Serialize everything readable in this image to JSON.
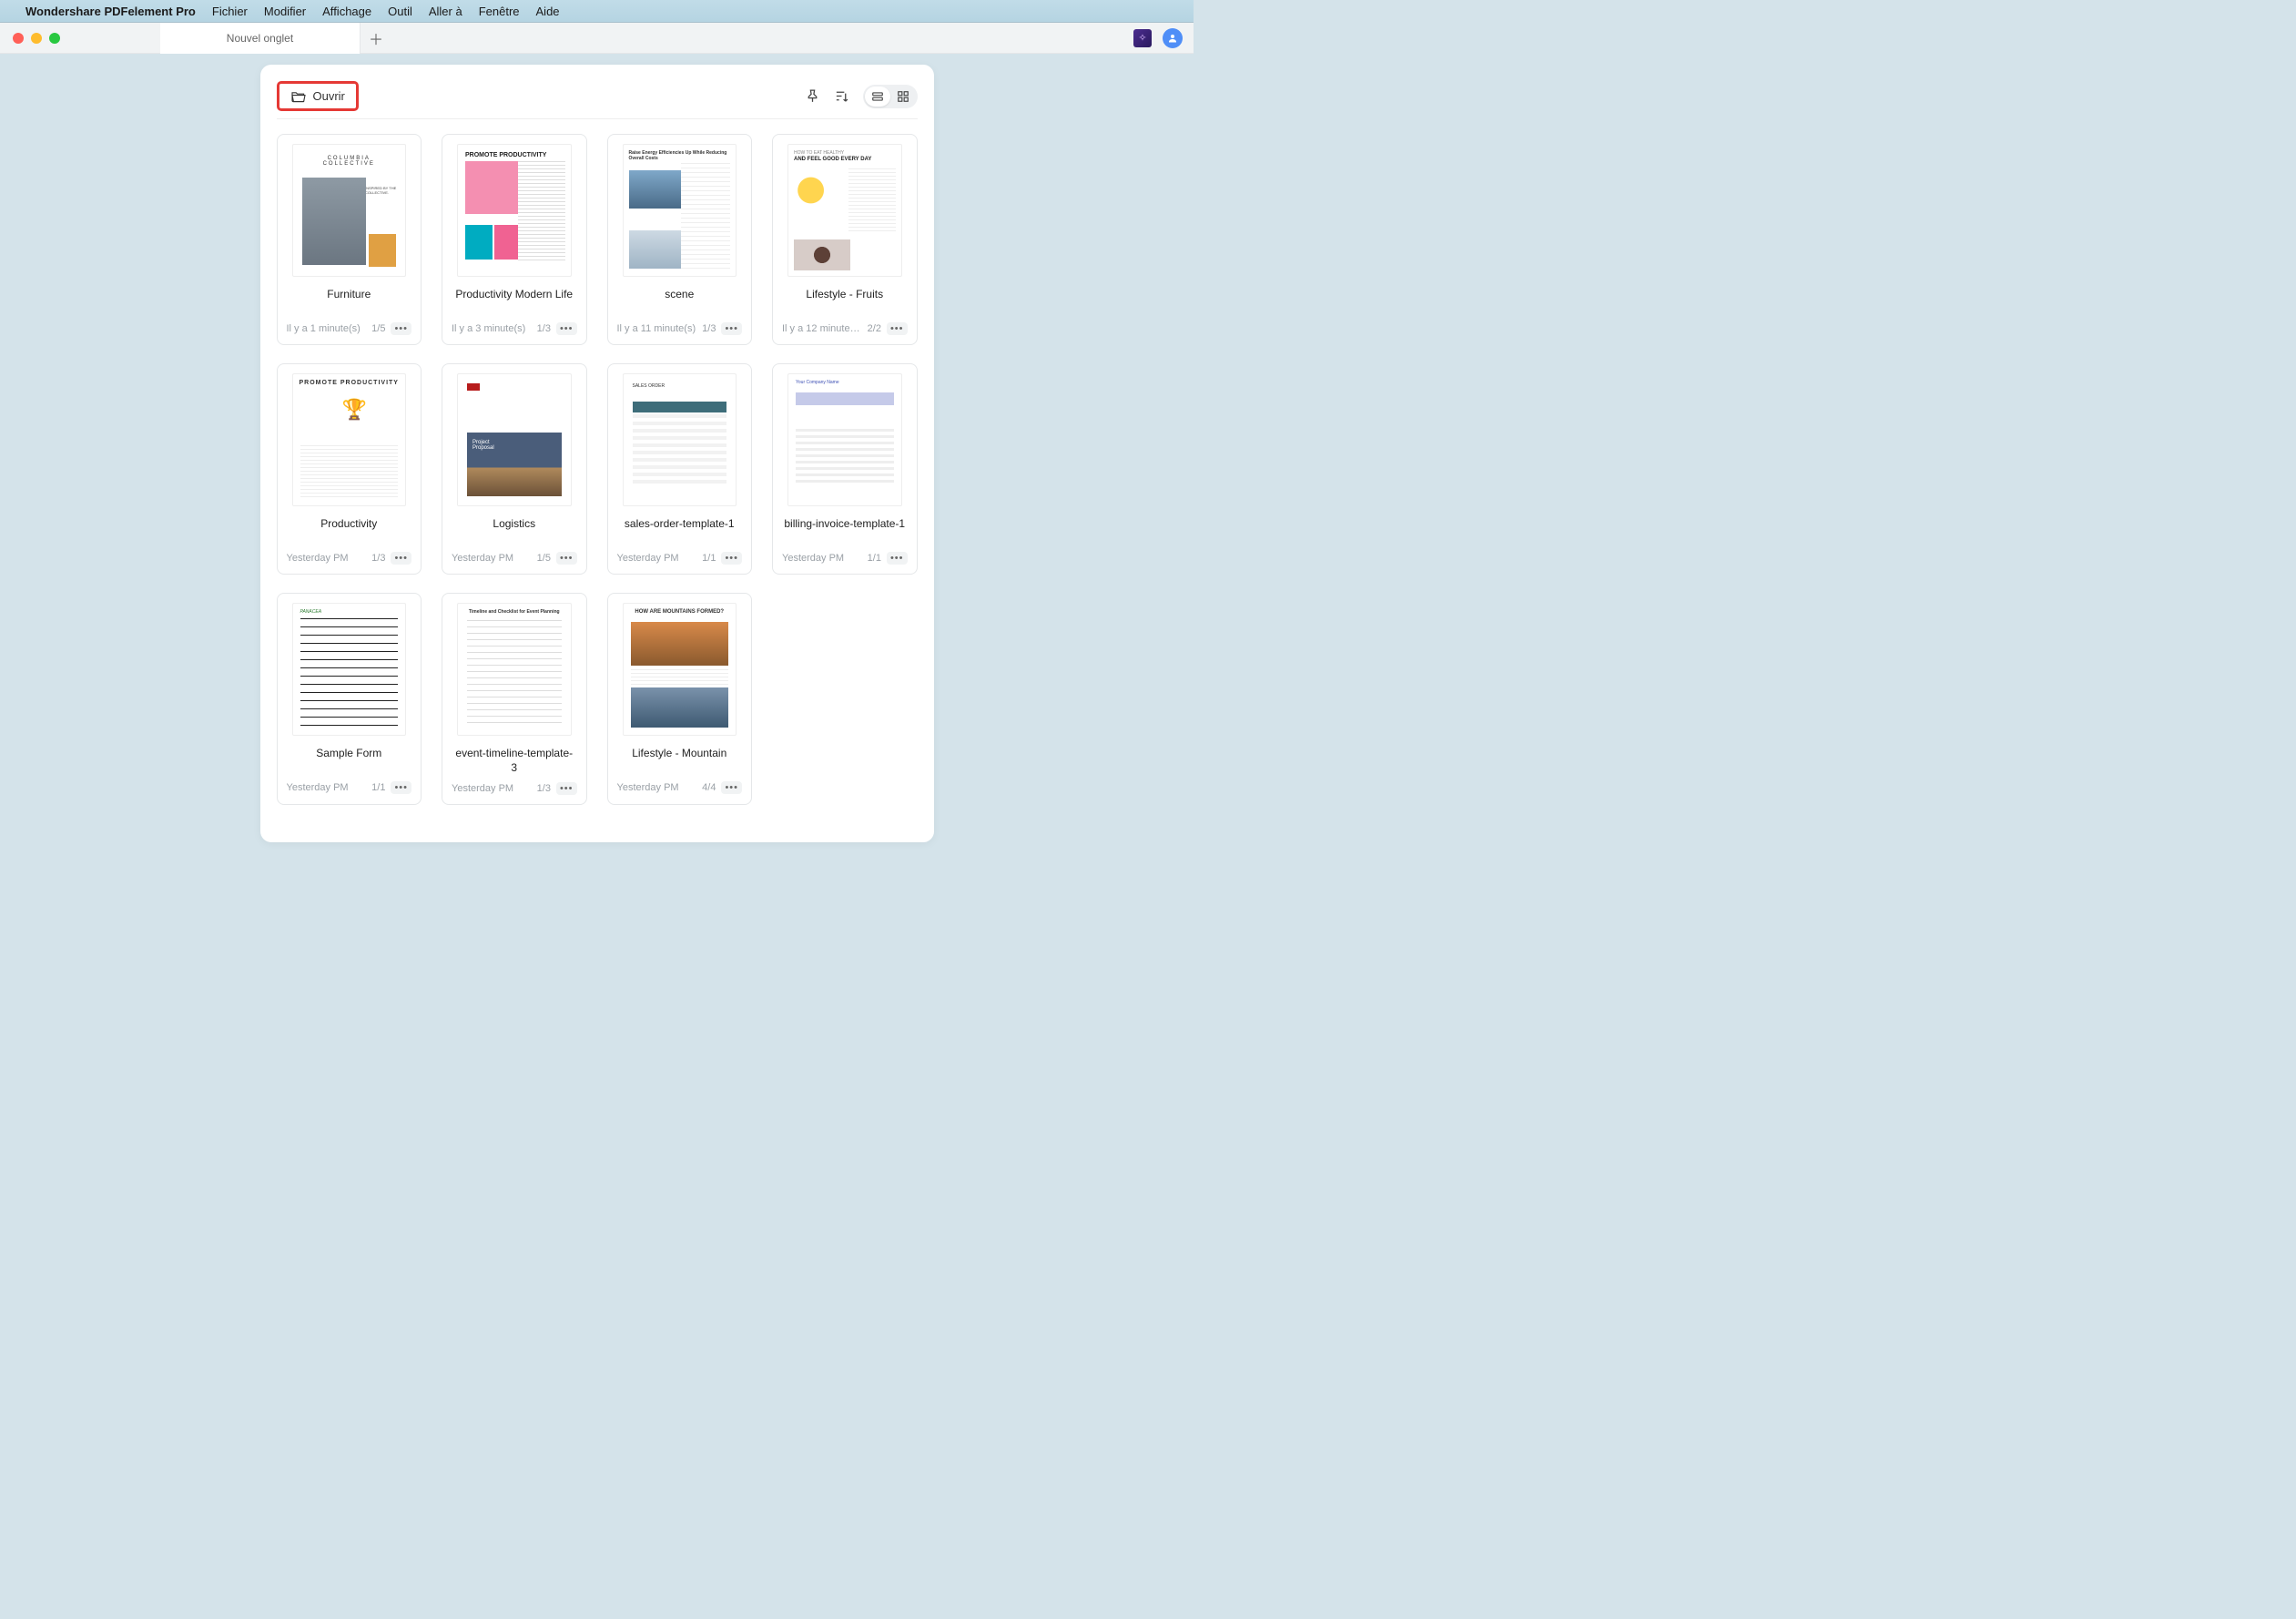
{
  "menubar": {
    "appname": "Wondershare PDFelement Pro",
    "items": [
      "Fichier",
      "Modifier",
      "Affichage",
      "Outil",
      "Aller à",
      "Fenêtre",
      "Aide"
    ]
  },
  "tabs": {
    "active": "Nouvel onglet"
  },
  "toolbar": {
    "open_label": "Ouvrir"
  },
  "documents": [
    {
      "title": "Furniture",
      "time": "Il y a 1 minute(s)",
      "pages": "1/5",
      "thumb": "furniture"
    },
    {
      "title": "Productivity Modern Life",
      "time": "Il y a 3 minute(s)",
      "pages": "1/3",
      "thumb": "prod"
    },
    {
      "title": "scene",
      "time": "Il y a 11 minute(s)",
      "pages": "1/3",
      "thumb": "scene"
    },
    {
      "title": "Lifestyle - Fruits",
      "time": "Il y a 12 minute…",
      "pages": "2/2",
      "thumb": "life"
    },
    {
      "title": "Productivity",
      "time": "Yesterday PM",
      "pages": "1/3",
      "thumb": "productivity"
    },
    {
      "title": "Logistics",
      "time": "Yesterday PM",
      "pages": "1/5",
      "thumb": "logistics"
    },
    {
      "title": "sales-order-template-1",
      "time": "Yesterday PM",
      "pages": "1/1",
      "thumb": "sales"
    },
    {
      "title": "billing-invoice-template-1",
      "time": "Yesterday PM",
      "pages": "1/1",
      "thumb": "billing"
    },
    {
      "title": "Sample Form",
      "time": "Yesterday PM",
      "pages": "1/1",
      "thumb": "sample"
    },
    {
      "title": "event-timeline-template-3",
      "time": "Yesterday PM",
      "pages": "1/3",
      "thumb": "event"
    },
    {
      "title": "Lifestyle - Mountain",
      "time": "Yesterday PM",
      "pages": "4/4",
      "thumb": "mountain"
    }
  ],
  "thumb_text": {
    "scene_hdr": "Raise Energy Efficiencies Up While Reducing Overall Costs",
    "life_hdr1": "HOW TO EAT HEALTHY",
    "life_hdr2": "AND FEEL GOOD EVERY DAY",
    "productivity_hdr": "PROMOTE PRODUCTIVITY",
    "prod_hdr": "PROMOTE PRODUCTIVITY",
    "sales_hdr": "SALES ORDER",
    "billing_nm": "Your Company Name",
    "sample_nm": "PANACEA",
    "event_hdr": "Timeline and Checklist for Event Planning",
    "mountain_hdr": "HOW ARE MOUNTAINS FORMED?",
    "furniture_caption": "INSPIRED BY THE COLLECTIVE."
  }
}
